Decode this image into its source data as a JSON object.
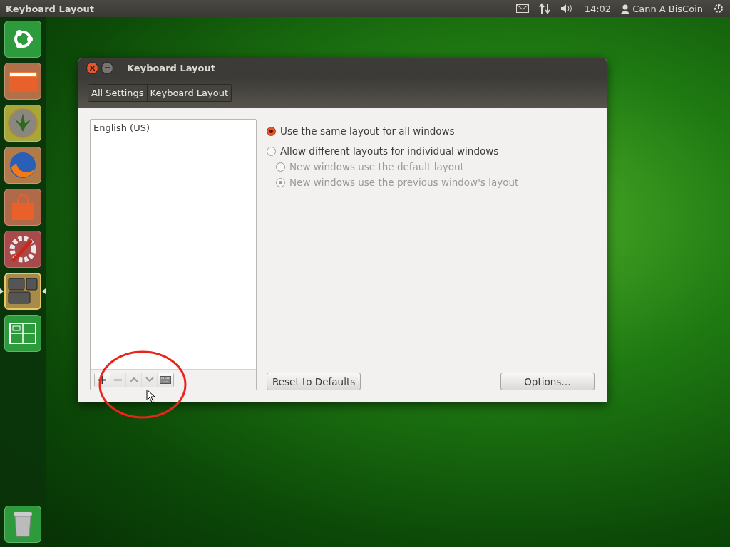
{
  "top_panel": {
    "title": "Keyboard Layout",
    "clock": "14:02",
    "user": "Cann A BisCoin"
  },
  "launcher": {
    "items": [
      {
        "kind": "home",
        "selected": false
      },
      {
        "kind": "files",
        "selected": false
      },
      {
        "kind": "coin",
        "selected": false
      },
      {
        "kind": "browser",
        "selected": false
      },
      {
        "kind": "store",
        "selected": false
      },
      {
        "kind": "settings",
        "selected": false
      },
      {
        "kind": "keyboard",
        "selected": true
      },
      {
        "kind": "workspaces",
        "selected": false
      }
    ],
    "trash": {
      "kind": "trash"
    }
  },
  "window": {
    "title": "Keyboard Layout",
    "breadcrumbs": [
      "All Settings",
      "Keyboard Layout"
    ],
    "layouts": [
      {
        "label": "English (US)",
        "selected": false
      }
    ],
    "list_tools": [
      {
        "kind": "add",
        "disabled": false
      },
      {
        "kind": "remove",
        "disabled": true
      },
      {
        "kind": "up",
        "disabled": true
      },
      {
        "kind": "down",
        "disabled": true
      },
      {
        "kind": "keyboard",
        "disabled": false
      }
    ],
    "options": [
      {
        "label": "Use the same layout for all windows",
        "selected": true,
        "disabled": false
      },
      {
        "label": "Allow different layouts for individual windows",
        "selected": false,
        "disabled": false,
        "children": [
          {
            "label": "New windows use the default layout",
            "selected": false,
            "disabled": true
          },
          {
            "label": "New windows use the previous window's layout",
            "selected": true,
            "disabled": true
          }
        ]
      }
    ],
    "buttons": [
      "Reset to Defaults",
      "Options…"
    ]
  }
}
